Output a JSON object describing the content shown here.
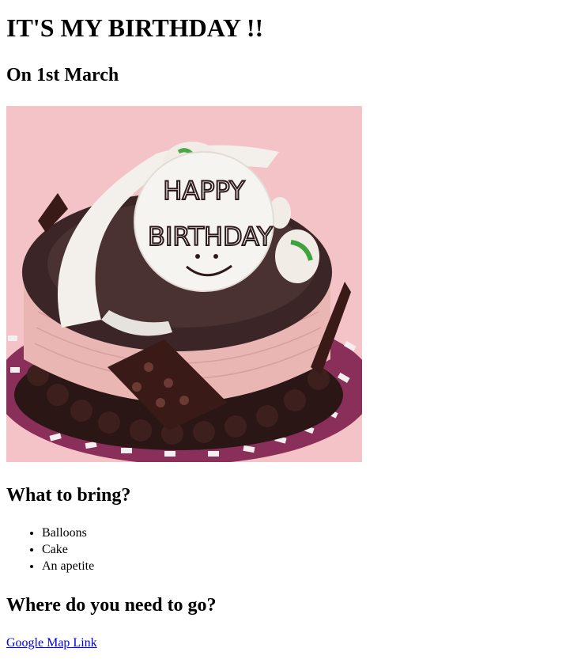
{
  "header": {
    "title": "IT'S MY BIRTHDAY !!",
    "date": "On 1st March"
  },
  "cake_image": {
    "topper_line1": "HAPPY",
    "topper_line2": "BIRTHDAY",
    "colors": {
      "background": "#f4c3c7",
      "chocolate": "#3b2526",
      "pink_frosting": "#e9b6b4",
      "board": "#8a2f5a",
      "white_chocolate": "#f3f0ec"
    }
  },
  "bring": {
    "heading": "What to bring?",
    "items": [
      "Balloons",
      "Cake",
      "An apetite"
    ]
  },
  "location": {
    "heading": "Where do you need to go?",
    "link_text": "Google Map Link"
  }
}
